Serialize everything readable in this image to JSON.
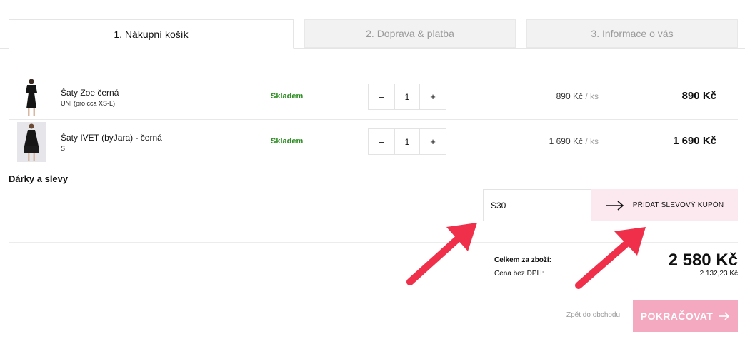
{
  "tabs": [
    {
      "label": "1. Nákupní košík",
      "active": true
    },
    {
      "label": "2. Doprava & platba",
      "active": false
    },
    {
      "label": "3. Informace o vás",
      "active": false
    }
  ],
  "cart": {
    "items": [
      {
        "name": "Šaty Zoe černá",
        "variant": "UNI (pro cca XS-L)",
        "stock": "Skladem",
        "qty_minus": "–",
        "quantity": "1",
        "qty_plus": "+",
        "unit_price": "890 Kč",
        "unit_suffix": " / ks",
        "total": "890 Kč",
        "thumb_icon": "dress-photo"
      },
      {
        "name": "Šaty IVET (byJara) - černá",
        "variant": "S",
        "stock": "Skladem",
        "qty_minus": "–",
        "quantity": "1",
        "qty_plus": "+",
        "unit_price": "1 690 Kč",
        "unit_suffix": " / ks",
        "total": "1 690 Kč",
        "thumb_icon": "dress-photo"
      }
    ]
  },
  "discounts": {
    "title": "Dárky a slevy",
    "coupon_value": "S30",
    "coupon_button": "PŘIDAT SLEVOVÝ KUPÓN"
  },
  "summary": {
    "goods_label": "Celkem za zboží:",
    "goods_total": "2 580 Kč",
    "net_label": "Cena bez DPH:",
    "net_total": "2 132,23 Kč"
  },
  "actions": {
    "back_label": "Zpět do obchodu",
    "continue_label": "POKRAČOVAT"
  },
  "colors": {
    "stock_green": "#2a8c1f",
    "coupon_bg": "#fce9ef",
    "continue_bg": "#f4a9c0",
    "annotation_arrow": "#f0304a"
  }
}
